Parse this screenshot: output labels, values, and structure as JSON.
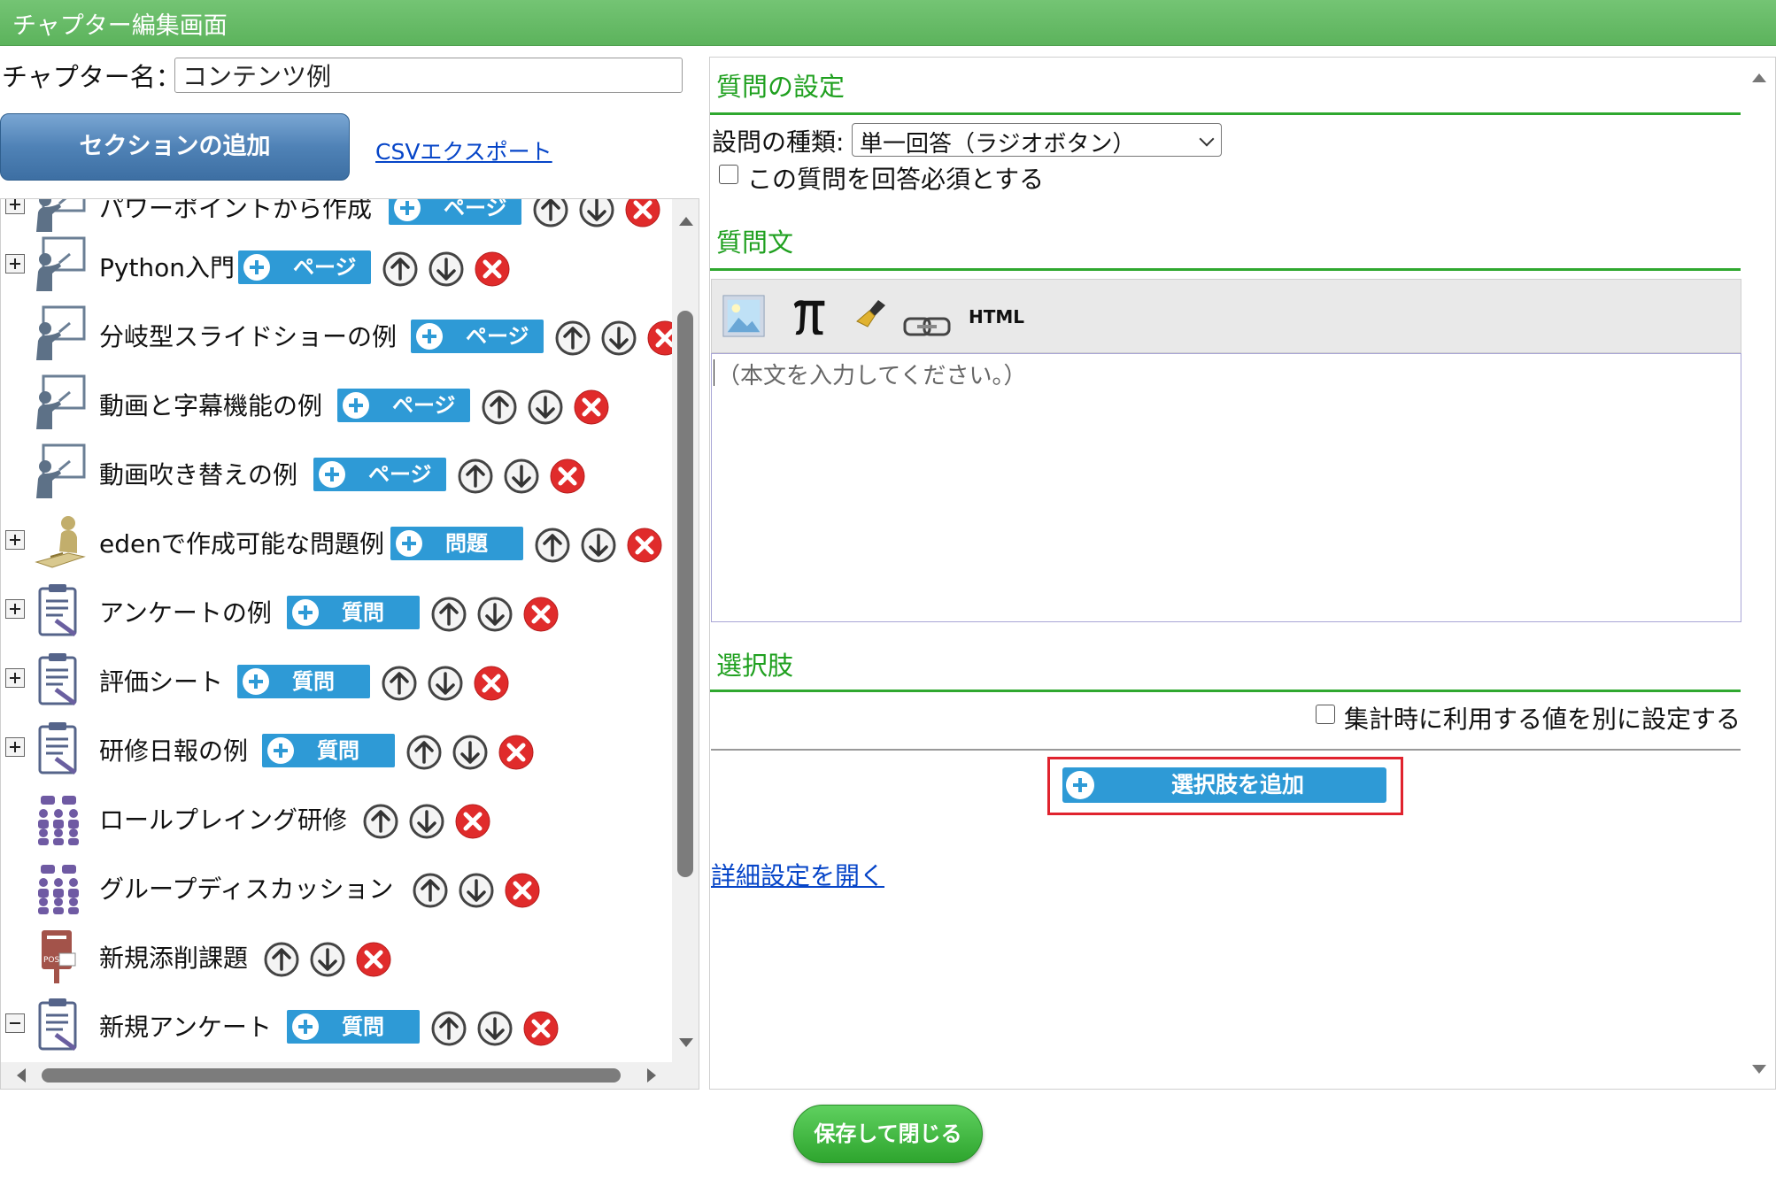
{
  "window": {
    "title": "チャプター編集画面"
  },
  "chapter": {
    "name_label": "チャプター名：",
    "name_value": "コンテンツ例"
  },
  "toolbar": {
    "add_section_label": "セクションの追加",
    "csv_export_label": "CSVエクスポート"
  },
  "tree": {
    "items": [
      {
        "label": "パワーポイントから作成",
        "icon": "presentation-icon",
        "pill": "ページ",
        "expander": "plus"
      },
      {
        "label": "Python入門",
        "icon": "presentation-icon",
        "pill": "ページ",
        "expander": "plus"
      },
      {
        "label": "分岐型スライドショーの例",
        "icon": "presentation-icon",
        "pill": "ページ",
        "expander": "none"
      },
      {
        "label": "動画と字幕機能の例",
        "icon": "presentation-icon",
        "pill": "ページ",
        "expander": "none"
      },
      {
        "label": "動画吹き替えの例",
        "icon": "presentation-icon",
        "pill": "ページ",
        "expander": "none"
      },
      {
        "label": "edenで作成可能な問題例",
        "icon": "test-writer-icon",
        "pill": "問題",
        "expander": "plus"
      },
      {
        "label": "アンケートの例",
        "icon": "clipboard-icon",
        "pill": "質問",
        "expander": "plus"
      },
      {
        "label": "評価シート",
        "icon": "clipboard-icon",
        "pill": "質問",
        "expander": "plus"
      },
      {
        "label": "研修日報の例",
        "icon": "clipboard-icon",
        "pill": "質問",
        "expander": "plus"
      },
      {
        "label": "ロールプレイング研修",
        "icon": "group-discussion-icon",
        "pill": "",
        "expander": "none"
      },
      {
        "label": "グループディスカッション",
        "icon": "group-discussion-icon",
        "pill": "",
        "expander": "none"
      },
      {
        "label": "新規添削課題",
        "icon": "post-box-icon",
        "pill": "",
        "expander": "none"
      },
      {
        "label": "新規アンケート",
        "icon": "clipboard-icon",
        "pill": "質問",
        "expander": "minus"
      }
    ]
  },
  "question": {
    "settings_title": "質問の設定",
    "type_label": "設問の種類:",
    "type_value": "単一回答（ラジオボタン）",
    "required_label": "この質問を回答必須とする",
    "text_title": "質問文",
    "toolbar_html_label": "HTML",
    "body_placeholder": "（本文を入力してください。）",
    "choices_title": "選択肢",
    "aggregate_label": "集計時に利用する値を別に設定する",
    "add_choice_label": "選択肢を追加",
    "advanced_link": "詳細設定を開く"
  },
  "footer": {
    "save_close_label": "保存して閉じる"
  },
  "colors": {
    "title_bar": "#5cb35c",
    "section_title": "#1fa01f",
    "pill": "#2e9ad6",
    "highlight": "#e0232e",
    "save": "#2ea52e"
  }
}
